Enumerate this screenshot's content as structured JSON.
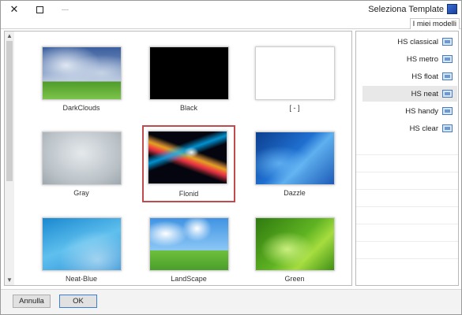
{
  "window": {
    "title": "Seleziona Template",
    "icon": "app-icon",
    "controls": [
      "close-icon",
      "maximize-icon",
      "minimize-icon"
    ]
  },
  "tabs": [
    {
      "label": "I miei modelli",
      "active": true
    }
  ],
  "gallery": {
    "templates": [
      {
        "name": "DarkClouds",
        "thumbnail": "dark-clouds-over-grass"
      },
      {
        "name": "Black",
        "thumbnail": "solid-black"
      },
      {
        "name": "[ - ]",
        "thumbnail": "blank-white"
      },
      {
        "name": "Gray",
        "thumbnail": "gray-texture"
      },
      {
        "name": "Flonid",
        "thumbnail": "colorful-light-streaks",
        "selected": true
      },
      {
        "name": "Dazzle",
        "thumbnail": "blue-waves"
      },
      {
        "name": "Neat-Blue",
        "thumbnail": "light-blue-abstract"
      },
      {
        "name": "LandScape",
        "thumbnail": "countryside-house"
      },
      {
        "name": "Green",
        "thumbnail": "green-abstract"
      }
    ]
  },
  "styles": {
    "items": [
      {
        "label": "HS classical",
        "icon": "layout-icon"
      },
      {
        "label": "HS metro",
        "icon": "layout-icon"
      },
      {
        "label": "HS float",
        "icon": "layout-icon"
      },
      {
        "label": "HS neat",
        "icon": "layout-icon",
        "selected": true
      },
      {
        "label": "HS handy",
        "icon": "layout-icon"
      },
      {
        "label": "HS clear",
        "icon": "layout-icon"
      }
    ]
  },
  "buttons": {
    "cancel_label": "Annulla",
    "ok_label": "OK"
  },
  "colors": {
    "selection_border": "#c24a4a",
    "ok_focus_border": "#3a7fd5",
    "list_selected_bg": "#e8e8e8"
  }
}
